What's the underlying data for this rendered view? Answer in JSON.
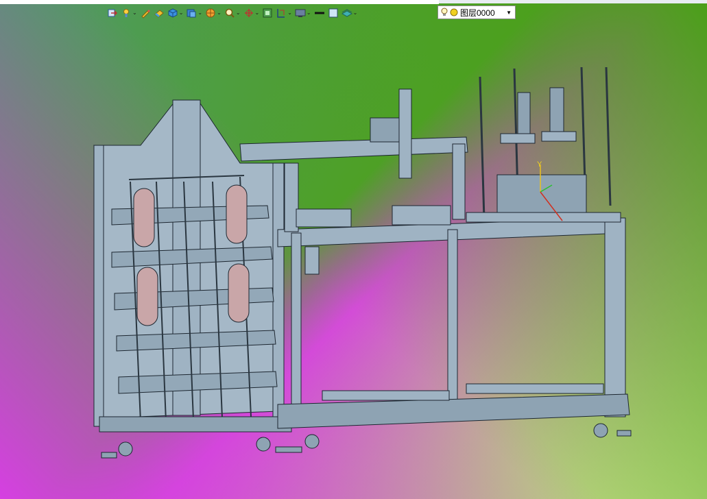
{
  "toolbar": {
    "buttons": [
      {
        "icon": "import-icon"
      },
      {
        "icon": "light-icon"
      },
      {
        "icon": "pen-icon"
      },
      {
        "icon": "eraser-icon"
      },
      {
        "icon": "cube-icon"
      },
      {
        "icon": "view-cube-icon"
      },
      {
        "icon": "render-ball-icon"
      },
      {
        "icon": "zoom-icon"
      },
      {
        "icon": "rotate-icon"
      },
      {
        "icon": "fit-icon"
      },
      {
        "icon": "section-icon"
      },
      {
        "icon": "display-icon"
      },
      {
        "icon": "line-weight-icon"
      },
      {
        "icon": "color-square-icon"
      },
      {
        "icon": "layer-stack-icon"
      }
    ]
  },
  "layer_selector": {
    "value": "图层0000"
  },
  "axis_label": "Y",
  "colors": {
    "frame": "#9fb3c3",
    "frame_line": "#1c2630",
    "panel": "#a9bcca"
  }
}
